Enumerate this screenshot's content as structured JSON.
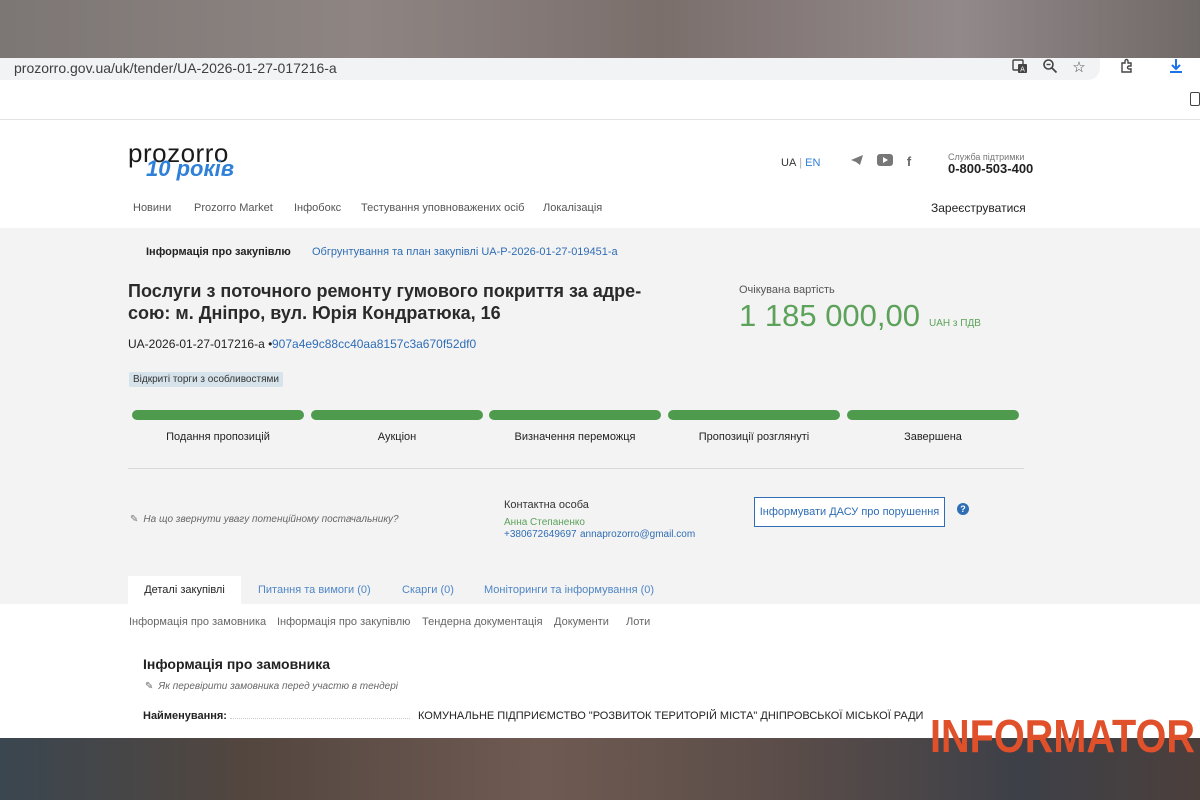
{
  "browser": {
    "url": "prozorro.gov.ua/uk/tender/UA-2026-01-27-017216-a",
    "icons": [
      "translate-icon",
      "zoom-icon",
      "star-icon",
      "extensions-icon",
      "download-icon"
    ]
  },
  "header": {
    "logo_word": "prozorro",
    "logo_years": "10 років",
    "lang_ua": "UA",
    "lang_en": "EN",
    "social": [
      "telegram-icon",
      "youtube-icon",
      "facebook-icon"
    ],
    "support_label": "Служба підтримки",
    "support_phone": "0-800-503-400",
    "nav": [
      "Новини",
      "Prozorro Market",
      "Інфобокс",
      "Тестування уповноважених осіб",
      "Локалізація"
    ],
    "register": "Зареєструватися"
  },
  "top_tabs": {
    "active": "Інформація про закупівлю",
    "link": "Обгрунтування та план закупівлі UA-P-2026-01-27-019451-a"
  },
  "tender": {
    "title": "Послуги з поточного ремонту гумового покриття за адре-сою: м. Дніпро, вул. Юрія Кондратюка, 16",
    "id": "UA-2026-01-27-017216-a  •",
    "hash": "907a4e9c88cc40aa8157c3a670f52df0",
    "status": "Відкриті торги з особливостями",
    "expected_label": "Очікувана вартість",
    "expected_value": "1 185 000,00",
    "expected_currency": "UAH з ПДВ"
  },
  "stages": [
    {
      "label": "Подання пропозицій",
      "complete": true
    },
    {
      "label": "Аукціон",
      "complete": true
    },
    {
      "label": "Визначення переможця",
      "complete": true
    },
    {
      "label": "Пропозиції розглянуті",
      "complete": true
    },
    {
      "label": "Завершена",
      "complete": true
    }
  ],
  "supplier_hint": "На що звернути увагу потенційному постачальнику?",
  "contact": {
    "label": "Контактна особа",
    "name": "Анна Степаненко",
    "phone": "+380672649697",
    "email": "annaprozorro@gmail.com"
  },
  "dasu_button": "Інформувати ДАСУ про порушення",
  "help": "?",
  "detail_tabs": [
    "Деталі закупівлі",
    "Питання та вимоги (0)",
    "Скарги (0)",
    "Моніторинги та інформування (0)"
  ],
  "subnav": [
    "Інформація про замовника",
    "Інформація про закупівлю",
    "Тендерна документація",
    "Документи",
    "Лоти"
  ],
  "customer": {
    "section_title": "Інформація про замовника",
    "hint": "Як перевірити замовника перед участю в тендері",
    "name_label": "Найменування:",
    "name_value": "КОМУНАЛЬНЕ ПІДПРИЄМСТВО \"РОЗВИТОК ТЕРИТОРІЙ МІСТА\" ДНІПРОВСЬКОЇ МІСЬКОЇ РАДИ"
  },
  "watermark": "INFORMATOR",
  "colors": {
    "accent": "#2f6db5",
    "green": "#4f9b4e",
    "watermark": "#e0502a"
  }
}
